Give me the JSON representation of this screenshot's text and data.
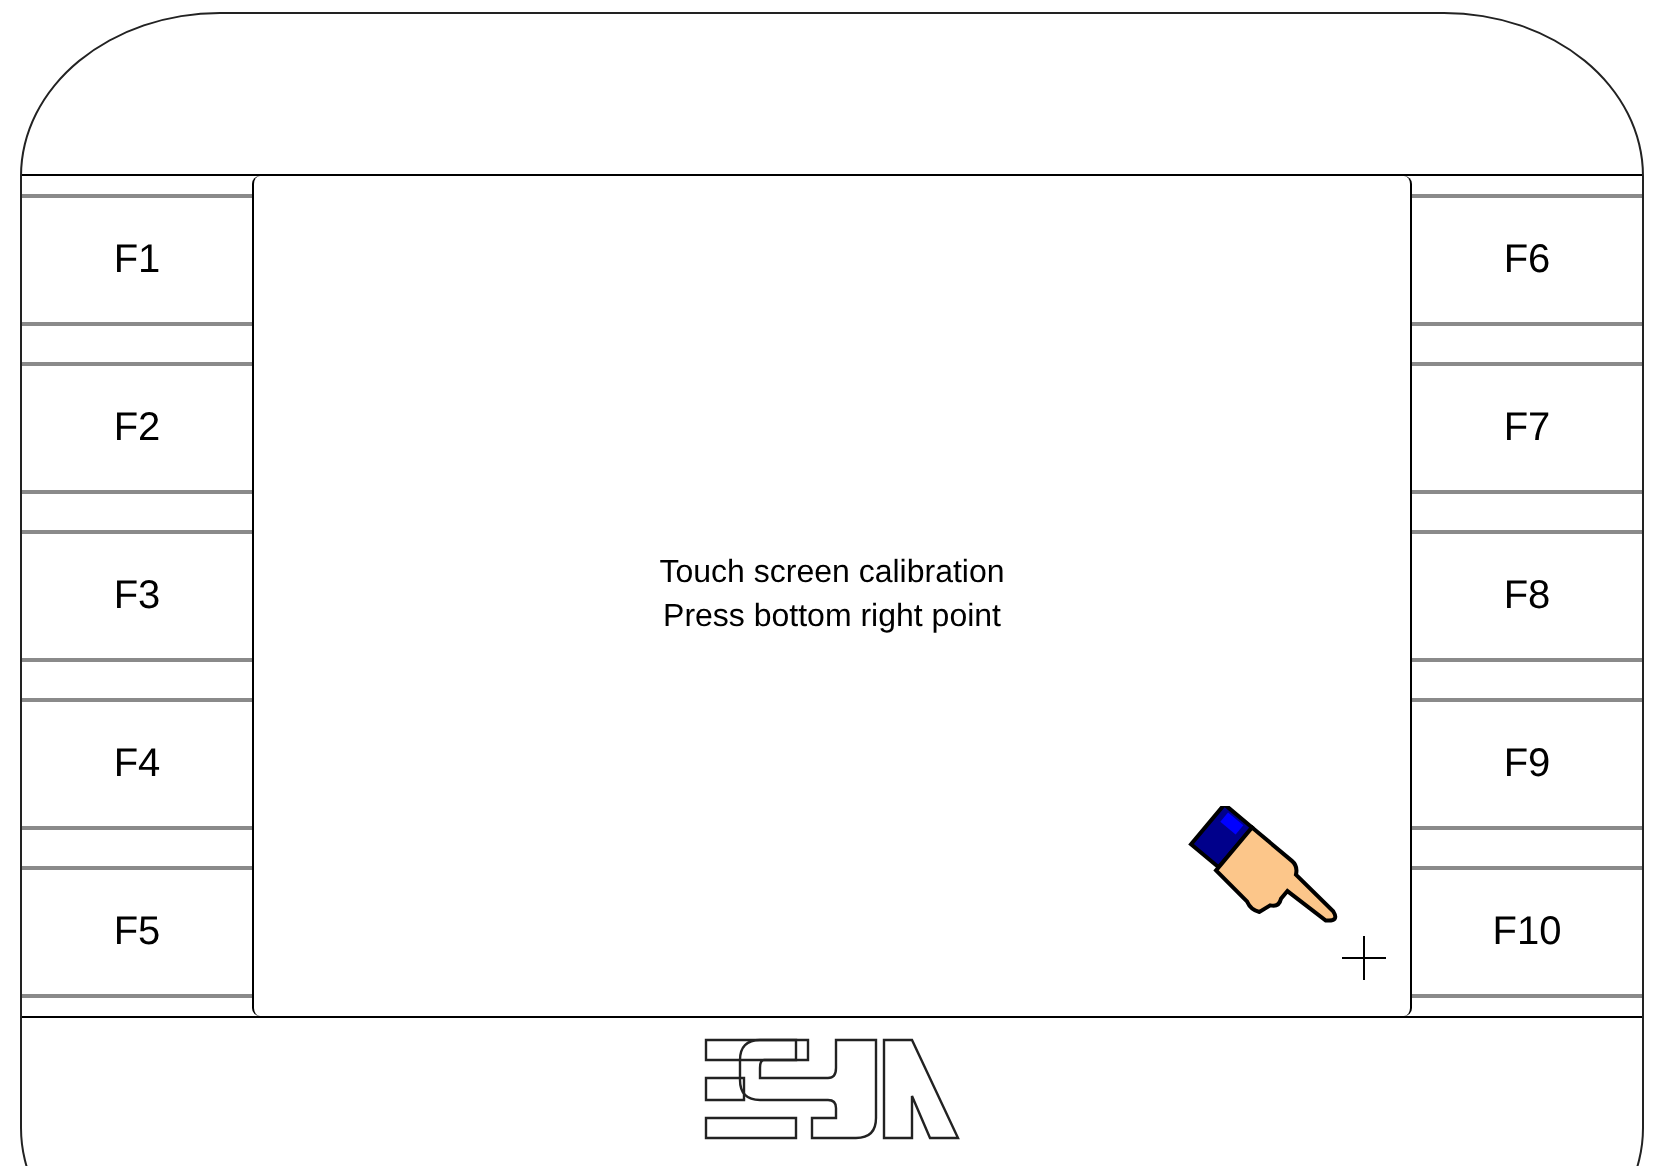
{
  "left_keys": [
    {
      "label": "F1"
    },
    {
      "label": "F2"
    },
    {
      "label": "F3"
    },
    {
      "label": "F4"
    },
    {
      "label": "F5"
    }
  ],
  "right_keys": [
    {
      "label": "F6"
    },
    {
      "label": "F7"
    },
    {
      "label": "F8"
    },
    {
      "label": "F9"
    },
    {
      "label": "F10"
    }
  ],
  "screen": {
    "title": "Touch screen calibration",
    "instruction": "Press bottom right point"
  }
}
